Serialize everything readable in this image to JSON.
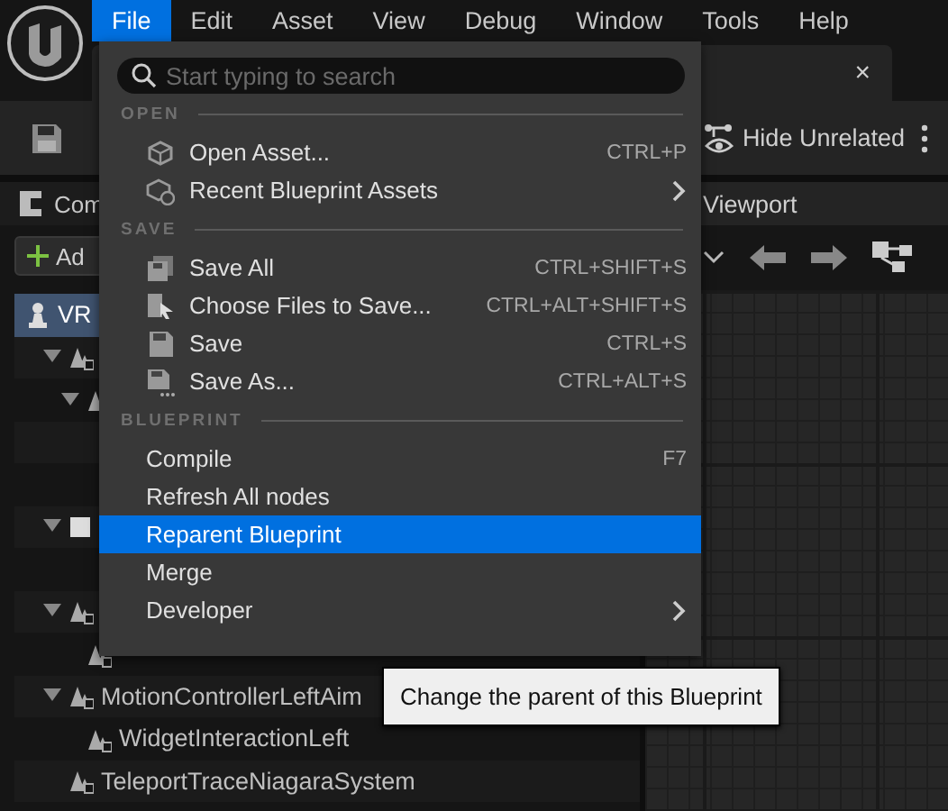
{
  "menubar": [
    {
      "label": "File",
      "selected": true
    },
    {
      "label": "Edit",
      "selected": false
    },
    {
      "label": "Asset",
      "selected": false
    },
    {
      "label": "View",
      "selected": false
    },
    {
      "label": "Debug",
      "selected": false
    },
    {
      "label": "Window",
      "selected": false
    },
    {
      "label": "Tools",
      "selected": false
    },
    {
      "label": "Help",
      "selected": false
    }
  ],
  "document_tab": {
    "close": "×"
  },
  "toolbar": {
    "hide_unrelated": "Hide Unrelated"
  },
  "components_panel": {
    "title": "Com",
    "add_button": "Ad",
    "tree": [
      {
        "label": "VR",
        "kind": "pawn",
        "selected": true,
        "children": [
          {
            "kind": "component",
            "expanded": true,
            "selected": false,
            "children": [
              {
                "kind": "component",
                "expanded": true,
                "selected": false,
                "children": [
                  {
                    "selected": false
                  },
                  {
                    "selected": false
                  }
                ]
              }
            ]
          },
          {
            "kind": "box",
            "expanded": true,
            "selected": false,
            "children": [
              {
                "selected": false
              }
            ]
          },
          {
            "kind": "component",
            "expanded": true,
            "selected": false,
            "children": [
              {
                "kind": "component",
                "selected": false
              }
            ]
          },
          {
            "label": "MotionControllerLeftAim",
            "kind": "component",
            "expanded": true,
            "selected": false,
            "children": [
              {
                "label": "WidgetInteractionLeft",
                "kind": "component",
                "selected": false
              }
            ]
          },
          {
            "label": "TeleportTraceNiagaraSystem",
            "kind": "component",
            "selected": false
          }
        ]
      }
    ]
  },
  "viewport_panel": {
    "tab": "Viewport"
  },
  "file_menu": {
    "search": {
      "placeholder": "Start typing to search"
    },
    "sections": [
      {
        "header": "OPEN",
        "items": [
          {
            "label": "Open Asset...",
            "shortcut": "CTRL+P",
            "kind": "open",
            "submenu": false,
            "selected": false
          },
          {
            "label": "Recent Blueprint Assets",
            "kind": "recent",
            "submenu": true,
            "selected": false
          }
        ]
      },
      {
        "header": "SAVE",
        "items": [
          {
            "label": "Save All",
            "shortcut": "CTRL+SHIFT+S",
            "kind": "save_all",
            "submenu": false,
            "selected": false
          },
          {
            "label": "Choose Files to Save...",
            "shortcut": "CTRL+ALT+SHIFT+S",
            "kind": "choose",
            "submenu": false,
            "selected": false
          },
          {
            "label": "Save",
            "shortcut": "CTRL+S",
            "kind": "save",
            "submenu": false,
            "selected": false
          },
          {
            "label": "Save As...",
            "shortcut": "CTRL+ALT+S",
            "kind": "save_as",
            "submenu": false,
            "selected": false
          }
        ]
      },
      {
        "header": "BLUEPRINT",
        "items": [
          {
            "label": "Compile",
            "shortcut": "F7",
            "submenu": false,
            "selected": false
          },
          {
            "label": "Refresh All nodes",
            "submenu": false,
            "selected": false
          },
          {
            "label": "Reparent Blueprint",
            "submenu": false,
            "selected": true
          },
          {
            "label": "Merge",
            "submenu": false,
            "selected": false
          },
          {
            "label": "Developer",
            "submenu": true,
            "selected": false
          }
        ]
      }
    ]
  },
  "tooltip": "Change the parent of this Blueprint"
}
